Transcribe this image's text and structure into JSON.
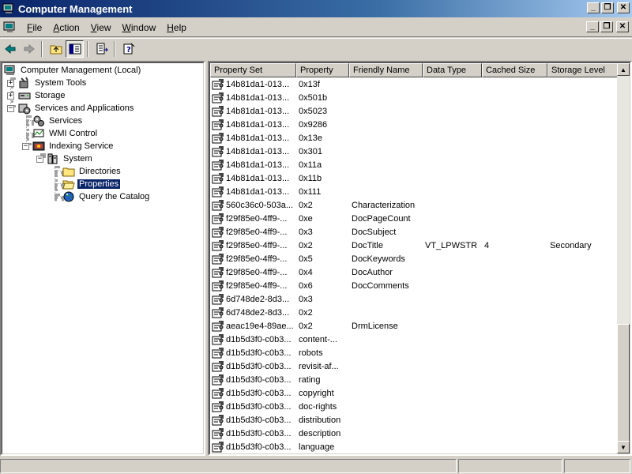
{
  "window": {
    "title": "Computer Management"
  },
  "menu": {
    "items": [
      "File",
      "Action",
      "View",
      "Window",
      "Help"
    ],
    "accel": [
      "F",
      "A",
      "V",
      "W",
      "H"
    ]
  },
  "toolbar": {
    "buttons": [
      "back-icon",
      "forward-icon",
      "up-folder-icon",
      "show-hide-tree-icon",
      "export-list-icon",
      "help-icon"
    ]
  },
  "tree": {
    "nodes": [
      {
        "label": "Computer Management (Local)",
        "icon": "computer-icon"
      },
      {
        "label": "System Tools",
        "icon": "tools-icon"
      },
      {
        "label": "Storage",
        "icon": "storage-icon"
      },
      {
        "label": "Services and Applications",
        "icon": "services-apps-icon"
      },
      {
        "label": "Services",
        "icon": "gears-icon"
      },
      {
        "label": "WMI Control",
        "icon": "wmi-icon"
      },
      {
        "label": "Indexing Service",
        "icon": "indexing-icon"
      },
      {
        "label": "System",
        "icon": "catalog-icon"
      },
      {
        "label": "Directories",
        "icon": "folder-icon"
      },
      {
        "label": "Properties",
        "icon": "open-folder-icon"
      },
      {
        "label": "Query the Catalog",
        "icon": "query-globe-icon"
      }
    ],
    "selected": "Properties"
  },
  "list": {
    "columns": [
      "Property Set",
      "Property",
      "Friendly Name",
      "Data Type",
      "Cached Size",
      "Storage Level"
    ],
    "rows": [
      [
        "14b81da1-013...",
        "0x13f",
        "",
        "",
        "",
        ""
      ],
      [
        "14b81da1-013...",
        "0x501b",
        "",
        "",
        "",
        ""
      ],
      [
        "14b81da1-013...",
        "0x5023",
        "",
        "",
        "",
        ""
      ],
      [
        "14b81da1-013...",
        "0x9286",
        "",
        "",
        "",
        ""
      ],
      [
        "14b81da1-013...",
        "0x13e",
        "",
        "",
        "",
        ""
      ],
      [
        "14b81da1-013...",
        "0x301",
        "",
        "",
        "",
        ""
      ],
      [
        "14b81da1-013...",
        "0x11a",
        "",
        "",
        "",
        ""
      ],
      [
        "14b81da1-013...",
        "0x11b",
        "",
        "",
        "",
        ""
      ],
      [
        "14b81da1-013...",
        "0x111",
        "",
        "",
        "",
        ""
      ],
      [
        "560c36c0-503a...",
        "0x2",
        "Characterization",
        "",
        "",
        ""
      ],
      [
        "f29f85e0-4ff9-...",
        "0xe",
        "DocPageCount",
        "",
        "",
        ""
      ],
      [
        "f29f85e0-4ff9-...",
        "0x3",
        "DocSubject",
        "",
        "",
        ""
      ],
      [
        "f29f85e0-4ff9-...",
        "0x2",
        "DocTitle",
        "VT_LPWSTR",
        "4",
        "Secondary"
      ],
      [
        "f29f85e0-4ff9-...",
        "0x5",
        "DocKeywords",
        "",
        "",
        ""
      ],
      [
        "f29f85e0-4ff9-...",
        "0x4",
        "DocAuthor",
        "",
        "",
        ""
      ],
      [
        "f29f85e0-4ff9-...",
        "0x6",
        "DocComments",
        "",
        "",
        ""
      ],
      [
        "6d748de2-8d3...",
        "0x3",
        "",
        "",
        "",
        ""
      ],
      [
        "6d748de2-8d3...",
        "0x2",
        "",
        "",
        "",
        ""
      ],
      [
        "aeac19e4-89ae...",
        "0x2",
        "DrmLicense",
        "",
        "",
        ""
      ],
      [
        "d1b5d3f0-c0b3...",
        "content-...",
        "",
        "",
        "",
        ""
      ],
      [
        "d1b5d3f0-c0b3...",
        "robots",
        "",
        "",
        "",
        ""
      ],
      [
        "d1b5d3f0-c0b3...",
        "revisit-af...",
        "",
        "",
        "",
        ""
      ],
      [
        "d1b5d3f0-c0b3...",
        "rating",
        "",
        "",
        "",
        ""
      ],
      [
        "d1b5d3f0-c0b3...",
        "copyright",
        "",
        "",
        "",
        ""
      ],
      [
        "d1b5d3f0-c0b3...",
        "doc-rights",
        "",
        "",
        "",
        ""
      ],
      [
        "d1b5d3f0-c0b3...",
        "distribution",
        "",
        "",
        "",
        ""
      ],
      [
        "d1b5d3f0-c0b3...",
        "description",
        "",
        "",
        "",
        ""
      ],
      [
        "d1b5d3f0-c0b3...",
        "language",
        "",
        "",
        "",
        ""
      ]
    ],
    "row_icon": "property-icon"
  },
  "colors": {
    "title_start": "#0a246a",
    "title_end": "#a6caf0",
    "selection": "#0a246a",
    "face": "#d4d0c8"
  }
}
